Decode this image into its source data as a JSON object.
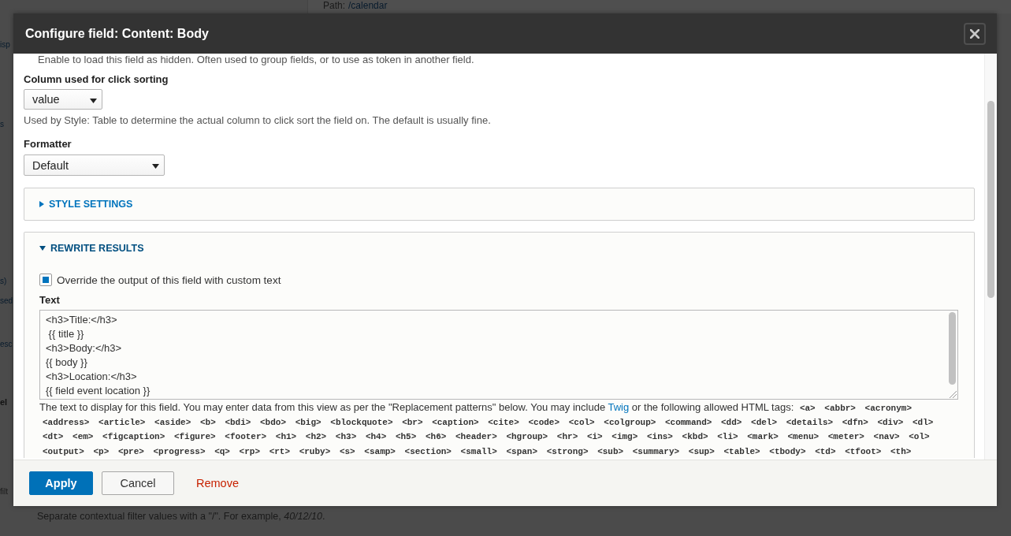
{
  "background_page": {
    "path": {
      "label": "Path:",
      "link": "/calendar"
    },
    "side_fragments": [
      {
        "text": "isp",
        "kind": "link"
      },
      {
        "text": "s",
        "kind": "link"
      },
      {
        "text": "s)",
        "kind": "link"
      },
      {
        "text": "sed",
        "kind": "link"
      },
      {
        "text": "esc",
        "kind": "link"
      },
      {
        "text": "el",
        "kind": "heading"
      },
      {
        "text": "filt",
        "kind": "text"
      }
    ],
    "note": "Separate contextual filter values with a \"/\". For example, *40/12/10*."
  },
  "dialog": {
    "title": "Configure field: Content: Body",
    "hint": "Enable to load this field as hidden. Often used to group fields, or to use as token in another field.",
    "fields": [
      {
        "label": "Column used for click sorting",
        "value": "value",
        "description": "Used by Style: Table to determine the actual column to click sort the field on. The default is usually fine."
      },
      {
        "label": "Formatter",
        "value": "Default"
      }
    ],
    "sections": [
      {
        "title": "STYLE SETTINGS",
        "expanded": false
      },
      {
        "title": "REWRITE RESULTS",
        "expanded": true,
        "override": {
          "label": "Override the output of this field with custom text",
          "checked": true
        },
        "text": {
          "label": "Text",
          "lines": [
            "<h3>Title:</h3>",
            " {{ title }}",
            "<h3>Body:</h3>",
            "{{ body }}",
            "<h3>Location:</h3>",
            "{{ field event location }}"
          ]
        },
        "help": {
          "before": "The text to display for this field. You may enter data from this view as per the \"Replacement patterns\" below. You may include",
          "link": "Twig",
          "after": "or the following allowed HTML tags:",
          "tags": [
            "<a>",
            "<abbr>",
            "<acronym>",
            "<address>",
            "<article>",
            "<aside>",
            "<b>",
            "<bdi>",
            "<bdo>",
            "<big>",
            "<blockquote>",
            "<br>",
            "<caption>",
            "<cite>",
            "<code>",
            "<col>",
            "<colgroup>",
            "<command>",
            "<dd>",
            "<del>",
            "<details>",
            "<dfn>",
            "<div>",
            "<dl>",
            "<dt>",
            "<em>",
            "<figcaption>",
            "<figure>",
            "<footer>",
            "<h1>",
            "<h2>",
            "<h3>",
            "<h4>",
            "<h5>",
            "<h6>",
            "<header>",
            "<hgroup>",
            "<hr>",
            "<i>",
            "<img>",
            "<ins>",
            "<kbd>",
            "<li>",
            "<mark>",
            "<menu>",
            "<meter>",
            "<nav>",
            "<ol>",
            "<output>",
            "<p>",
            "<pre>",
            "<progress>",
            "<q>",
            "<rp>",
            "<rt>",
            "<ruby>",
            "<s>",
            "<samp>",
            "<section>",
            "<small>",
            "<span>",
            "<strong>",
            "<sub>",
            "<summary>",
            "<sup>",
            "<table>",
            "<tbody>",
            "<td>",
            "<tfoot>",
            "<th>"
          ]
        }
      }
    ],
    "buttons": [
      {
        "label": "Apply",
        "kind": "primary"
      },
      {
        "label": "Cancel",
        "kind": "secondary"
      },
      {
        "label": "Remove",
        "kind": "danger"
      }
    ]
  }
}
